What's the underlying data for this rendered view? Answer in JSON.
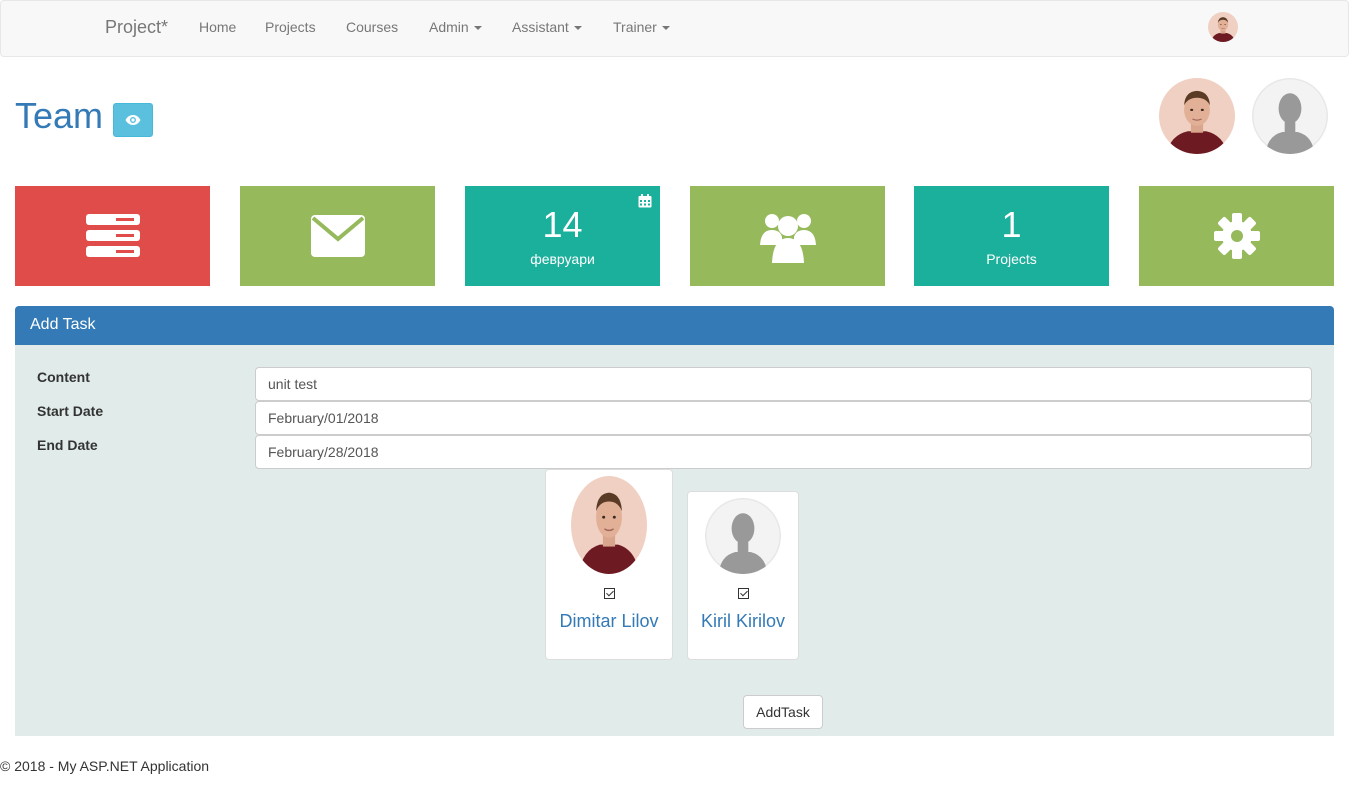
{
  "navbar": {
    "brand": "Project*",
    "items": [
      {
        "label": "Home"
      },
      {
        "label": "Projects"
      },
      {
        "label": "Courses"
      },
      {
        "label": "Admin"
      },
      {
        "label": "Assistant"
      },
      {
        "label": "Trainer"
      }
    ]
  },
  "header": {
    "title": "Team"
  },
  "tiles": [
    {
      "icon": "server-icon",
      "color": "#e04c4a"
    },
    {
      "icon": "envelope-icon",
      "color": "#96b95c"
    },
    {
      "icon": "calendar-icon",
      "color": "#1bb09c",
      "number": "14",
      "sub": "февруари"
    },
    {
      "icon": "users-icon",
      "color": "#96b95c"
    },
    {
      "icon": "projects-count",
      "color": "#1bb09c",
      "number": "1",
      "sub": "Projects"
    },
    {
      "icon": "gear-icon",
      "color": "#96b95c"
    }
  ],
  "panel": {
    "title": "Add Task",
    "fields": {
      "content": {
        "label": "Content",
        "value": "unit test"
      },
      "start": {
        "label": "Start Date",
        "value": "February/01/2018"
      },
      "end": {
        "label": "End Date",
        "value": "February/28/2018"
      }
    },
    "members": [
      {
        "name": "Dimitar Lilov",
        "checked": true
      },
      {
        "name": "Kiril Kirilov",
        "checked": true
      }
    ],
    "submit_label": "AddTask"
  },
  "footer": {
    "text": "© 2018 - My ASP.NET Application"
  }
}
